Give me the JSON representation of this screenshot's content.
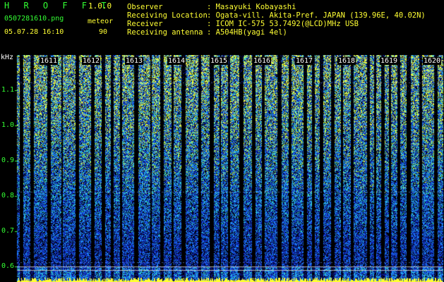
{
  "header": {
    "app_name": "H R O F F T",
    "app_version": "1.0.0",
    "filename": "0507281610.png",
    "mode": "meteor",
    "datetime": "05.07.28 16:10",
    "count": "90"
  },
  "info": {
    "observer_label": "Observer",
    "observer_value": ": Masayuki Kobayashi",
    "location_label": "Receiving Location",
    "location_value": ": Ogata-vill. Akita-Pref. JAPAN (139.96E, 40.02N)",
    "receiver_label": "Receiver",
    "receiver_value": ": ICOM IC-575 53.7492(@LCD)MHz USB",
    "antenna_label": "Receiving antenna",
    "antenna_value": ": A504HB(yagi 4el)"
  },
  "spectrogram": {
    "freq_unit": "kHz",
    "freq_ticks": [
      "1.1",
      "1.0",
      "0.9",
      "0.8",
      "0.7",
      "0.6"
    ],
    "time_ticks": [
      "1611",
      "1612",
      "1613",
      "1614",
      "1615",
      "1616",
      "1617",
      "1618",
      "1619",
      "1620"
    ],
    "colors": {
      "background": "#000000",
      "low": "#0a1a8c",
      "mid": "#1e6bff",
      "high": "#2fd8c8",
      "peak": "#ffff33"
    }
  }
}
